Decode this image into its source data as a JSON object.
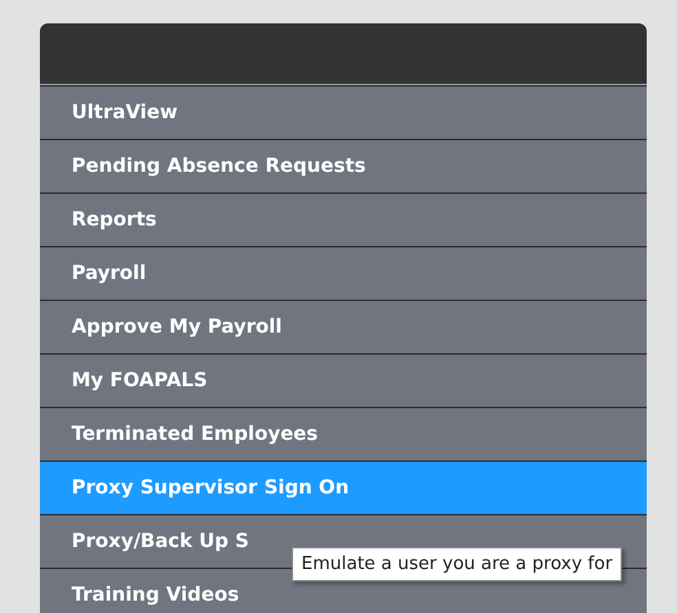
{
  "menu": {
    "items": [
      {
        "label": "UltraView",
        "selected": false
      },
      {
        "label": "Pending Absence Requests",
        "selected": false
      },
      {
        "label": "Reports",
        "selected": false
      },
      {
        "label": "Payroll",
        "selected": false
      },
      {
        "label": "Approve My Payroll",
        "selected": false
      },
      {
        "label": "My FOAPALS",
        "selected": false
      },
      {
        "label": "Terminated Employees",
        "selected": false
      },
      {
        "label": "Proxy Supervisor Sign On",
        "selected": true
      },
      {
        "label": "Proxy/Back Up S",
        "selected": false
      },
      {
        "label": "Training Videos",
        "selected": false
      }
    ]
  },
  "tooltip": {
    "text": "Emulate a user you are a proxy for"
  }
}
